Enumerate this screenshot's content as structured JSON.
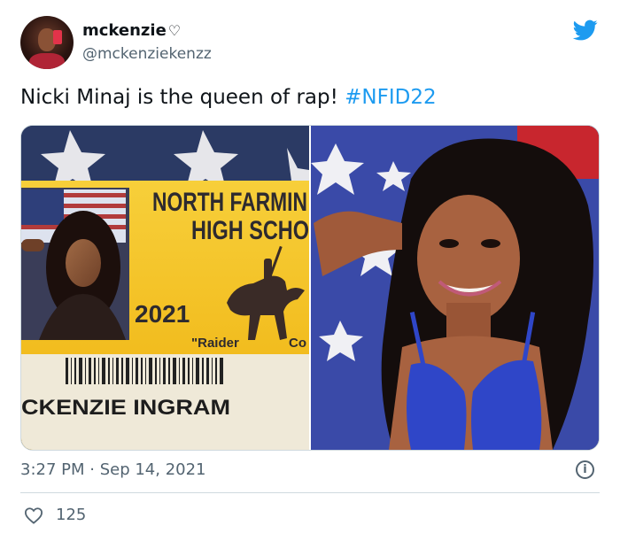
{
  "author": {
    "display_name": "mckenzie",
    "name_emoji": "♡",
    "handle": "@mckenziekenzz"
  },
  "tweet": {
    "text": "Nicki Minaj is the queen of rap! ",
    "hashtag": "#NFID22",
    "timestamp": "3:27 PM · Sep 14, 2021",
    "like_count": "125"
  },
  "media": {
    "id_card": {
      "school_line1": "NORTH FARMIN",
      "school_line2": "HIGH SCHO",
      "year": "2021",
      "mascot": "\"Raider",
      "mascot_cut": "Co",
      "student_name": "CKENZIE INGRAM"
    }
  },
  "colors": {
    "link": "#1d9bf0",
    "secondary_text": "#536471",
    "divider": "#cfd9de",
    "twitter_blue": "#1d9bf0",
    "card_yellow": "#f5c21a"
  },
  "icons": {
    "brand": "twitter-bird-icon",
    "info": "info-icon",
    "like": "heart-icon"
  }
}
